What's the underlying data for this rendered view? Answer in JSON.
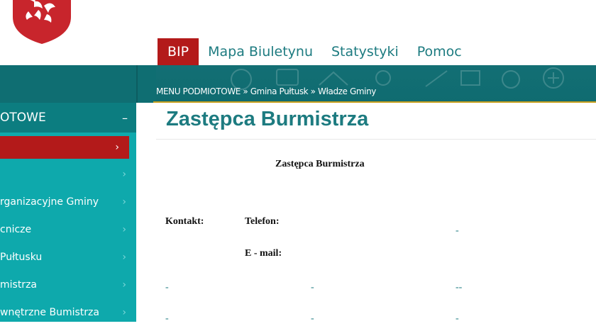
{
  "header": {
    "nav": [
      {
        "label": "BIP"
      },
      {
        "label": "Mapa Biuletynu"
      },
      {
        "label": "Statystyki"
      },
      {
        "label": "Pomoc"
      }
    ]
  },
  "breadcrumb": {
    "items": [
      "MENU PODMIOTOWE",
      "Gmina Pułtusk",
      "Władze Gminy"
    ],
    "separator": " » "
  },
  "sidebar": {
    "header_label": "OTOWE",
    "collapse_symbol": "–",
    "items": [
      {
        "label": "",
        "chevron": "›"
      },
      {
        "label": "",
        "chevron": "›"
      },
      {
        "label": "rganizacyjne Gminy",
        "chevron": "›"
      },
      {
        "label": "cnicze",
        "chevron": "›"
      },
      {
        "label": "Pułtusku",
        "chevron": "›"
      },
      {
        "label": "mistrza",
        "chevron": "›"
      },
      {
        "label": "wnętrzne Bumistrza",
        "chevron": "›"
      }
    ]
  },
  "main": {
    "title": "Zastępca Burmistrza",
    "subtitle": "Zastępca Burmistrza",
    "contact_label": "Kontakt:",
    "phone_label": "Telefon:",
    "email_label": "E - mail:",
    "phone_value": "-",
    "row1": [
      "-",
      "-",
      "--"
    ],
    "row2": [
      "-",
      "-",
      "-"
    ]
  },
  "colors": {
    "accent_red": "#b31a1a",
    "teal_dark": "#0f6e72",
    "teal_sidebar": "#0ea9ac",
    "teal_text": "#1d7b80"
  }
}
